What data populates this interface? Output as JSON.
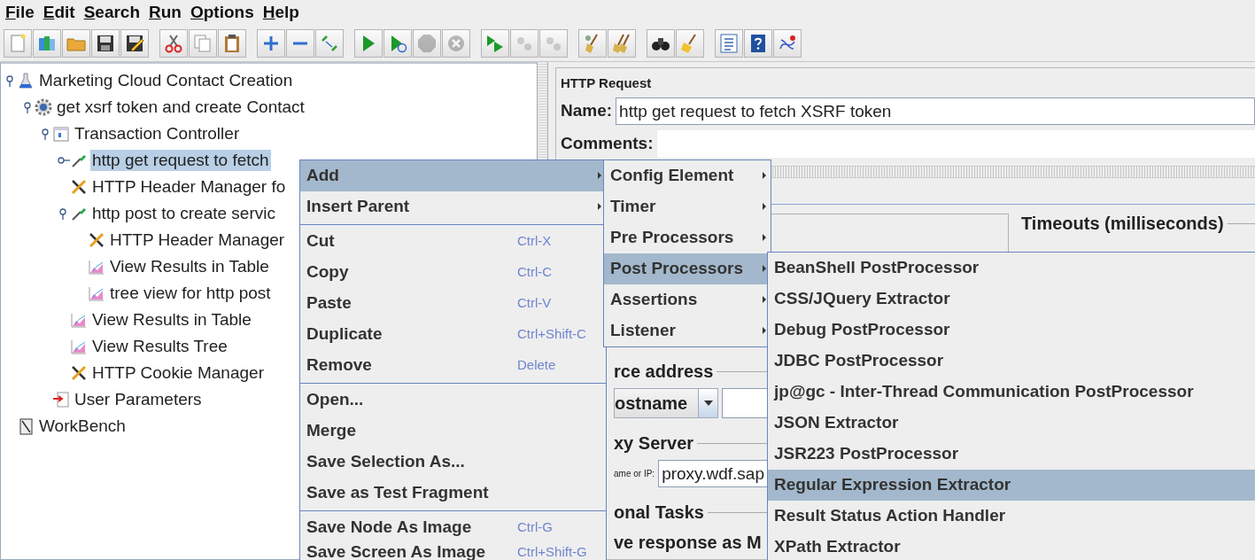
{
  "menubar": [
    {
      "label": "File"
    },
    {
      "label": "Edit"
    },
    {
      "label": "Search"
    },
    {
      "label": "Run"
    },
    {
      "label": "Options"
    },
    {
      "label": "Help"
    }
  ],
  "toolbar": [
    [
      {
        "kind": "new",
        "disabled": false
      },
      {
        "kind": "templates",
        "disabled": false
      },
      {
        "kind": "open",
        "disabled": false
      },
      {
        "kind": "save",
        "disabled": false
      },
      {
        "kind": "save-as",
        "disabled": false
      }
    ],
    [
      {
        "kind": "cut",
        "disabled": false
      },
      {
        "kind": "copy",
        "disabled": false
      },
      {
        "kind": "paste",
        "disabled": false
      }
    ],
    [
      {
        "kind": "expand",
        "disabled": false
      },
      {
        "kind": "collapse",
        "disabled": false
      },
      {
        "kind": "toggle",
        "disabled": false
      }
    ],
    [
      {
        "kind": "start",
        "disabled": false
      },
      {
        "kind": "start-no-pause",
        "disabled": false
      },
      {
        "kind": "stop",
        "disabled": true
      },
      {
        "kind": "shutdown",
        "disabled": true
      }
    ],
    [
      {
        "kind": "remote-start",
        "disabled": false
      },
      {
        "kind": "remote-stop",
        "disabled": true
      },
      {
        "kind": "remote-exit",
        "disabled": true
      }
    ],
    [
      {
        "kind": "clear",
        "disabled": false
      },
      {
        "kind": "clear-all",
        "disabled": false
      }
    ],
    [
      {
        "kind": "search",
        "disabled": false
      },
      {
        "kind": "reset-search",
        "disabled": false
      }
    ],
    [
      {
        "kind": "function-helper",
        "disabled": false
      },
      {
        "kind": "help",
        "disabled": false
      },
      {
        "kind": "log",
        "disabled": false
      }
    ]
  ],
  "tree": [
    {
      "label": "Marketing Cloud Contact Creation",
      "kind": "test-plan",
      "expanded": true,
      "selected": false,
      "children": [
        {
          "label": "get xsrf token and create Contact",
          "kind": "thread-group",
          "expanded": true,
          "selected": false,
          "children": [
            {
              "label": "Transaction Controller",
              "kind": "controller",
              "expanded": true,
              "selected": false,
              "children": [
                {
                  "label": "http get request to fetch",
                  "kind": "sampler",
                  "expanded": false,
                  "selected": true
                },
                {
                  "label": "HTTP Header Manager fo",
                  "kind": "config",
                  "selected": false
                },
                {
                  "label": "http post to create servic",
                  "kind": "sampler",
                  "expanded": true,
                  "selected": false,
                  "children": [
                    {
                      "label": "HTTP Header Manager",
                      "kind": "config",
                      "selected": false
                    },
                    {
                      "label": "View Results in Table",
                      "kind": "listener",
                      "selected": false
                    },
                    {
                      "label": "tree view for http post",
                      "kind": "listener",
                      "selected": false
                    }
                  ]
                },
                {
                  "label": "View Results in Table",
                  "kind": "listener",
                  "selected": false
                },
                {
                  "label": "View Results Tree",
                  "kind": "listener",
                  "selected": false
                },
                {
                  "label": "HTTP Cookie Manager",
                  "kind": "config",
                  "selected": false
                }
              ]
            },
            {
              "label": "User Parameters",
              "kind": "preprocessor",
              "selected": false
            }
          ]
        }
      ]
    },
    {
      "label": "WorkBench",
      "kind": "workbench",
      "selected": false
    }
  ],
  "request_panel": {
    "title": "HTTP Request",
    "name_label": "Name:",
    "name_value": "http get request to fetch XSRF token",
    "comments_label": "Comments:",
    "timeouts_title": "Timeouts (milliseconds)",
    "sections": [
      {
        "kind": "combo",
        "title": "rce address",
        "value": "ostname"
      },
      {
        "kind": "field",
        "title": "xy Server",
        "field_label": "ame or IP:",
        "value": "proxy.wdf.sap"
      },
      {
        "kind": "text",
        "title": "onal Tasks",
        "text": "ve response as M"
      }
    ]
  },
  "context_menu": [
    [
      {
        "label": "Add",
        "submenu": true,
        "selected": true
      },
      {
        "label": "Insert Parent",
        "submenu": true,
        "selected": false
      }
    ],
    [
      {
        "label": "Cut",
        "shortcut": "Ctrl-X",
        "selected": false
      },
      {
        "label": "Copy",
        "shortcut": "Ctrl-C",
        "selected": false
      },
      {
        "label": "Paste",
        "shortcut": "Ctrl-V",
        "selected": false
      },
      {
        "label": "Duplicate",
        "shortcut": "Ctrl+Shift-C",
        "selected": false
      },
      {
        "label": "Remove",
        "shortcut": "Delete",
        "selected": false
      }
    ],
    [
      {
        "label": "Open...",
        "selected": false
      },
      {
        "label": "Merge",
        "selected": false
      },
      {
        "label": "Save Selection As...",
        "selected": false
      },
      {
        "label": "Save as Test Fragment",
        "selected": false
      }
    ],
    [
      {
        "label": "Save Node As Image",
        "shortcut": "Ctrl-G",
        "selected": false
      },
      {
        "label": "Save Screen As Image",
        "shortcut": "Ctrl+Shift-G",
        "selected": false
      }
    ]
  ],
  "add_submenu": [
    {
      "label": "Config Element",
      "submenu": true,
      "selected": false
    },
    {
      "label": "Timer",
      "submenu": true,
      "selected": false
    },
    {
      "label": "Pre Processors",
      "submenu": true,
      "selected": false
    },
    {
      "label": "Post Processors",
      "submenu": true,
      "selected": true
    },
    {
      "label": "Assertions",
      "submenu": true,
      "selected": false
    },
    {
      "label": "Listener",
      "submenu": true,
      "selected": false
    }
  ],
  "post_processors_submenu": [
    {
      "label": "BeanShell PostProcessor",
      "selected": false
    },
    {
      "label": "CSS/JQuery Extractor",
      "selected": false
    },
    {
      "label": "Debug PostProcessor",
      "selected": false
    },
    {
      "label": "JDBC PostProcessor",
      "selected": false
    },
    {
      "label": "jp@gc - Inter-Thread Communication PostProcessor",
      "selected": false
    },
    {
      "label": "JSON Extractor",
      "selected": false
    },
    {
      "label": "JSR223 PostProcessor",
      "selected": false
    },
    {
      "label": "Regular Expression Extractor",
      "selected": true
    },
    {
      "label": "Result Status Action Handler",
      "selected": false
    },
    {
      "label": "XPath Extractor",
      "selected": false
    }
  ]
}
